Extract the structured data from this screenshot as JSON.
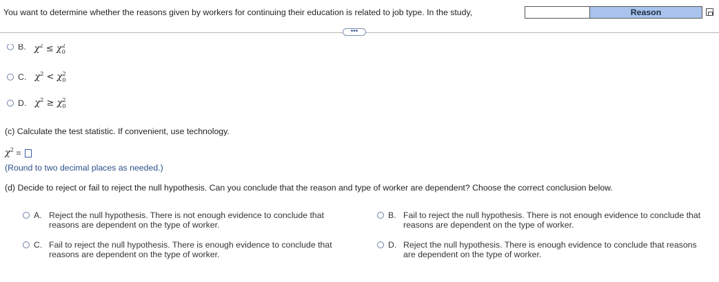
{
  "question_text": "You want to determine whether the reasons given by workers for continuing their education is related to job type. In the study,",
  "table_header": "Reason",
  "more_label": "•••",
  "part_b_options": [
    {
      "letter": "B.",
      "symbol": "≤"
    },
    {
      "letter": "C.",
      "symbol": "<"
    },
    {
      "letter": "D.",
      "symbol": "≥"
    }
  ],
  "chi": "χ",
  "sup2": "2",
  "sub0": "0",
  "part_c": {
    "prompt": "(c) Calculate the test statistic. If convenient, use technology.",
    "equals": "=",
    "hint": "(Round to two decimal places as needed.)"
  },
  "part_d": {
    "prompt": "(d) Decide to reject or fail to reject the null hypothesis. Can you conclude that the reason and type of worker are dependent? Choose the correct conclusion below.",
    "choices": [
      {
        "letter": "A.",
        "line1": "Reject the null hypothesis. There is not enough evidence to conclude that",
        "line2": "reasons are dependent on the type of worker."
      },
      {
        "letter": "B.",
        "line1": "Fail to reject the null hypothesis. There is not enough evidence to conclude that",
        "line2": "reasons are dependent on the type of worker."
      },
      {
        "letter": "C.",
        "line1": "Fail to reject the null hypothesis. There is enough evidence to conclude that",
        "line2": "reasons are dependent on the type of worker."
      },
      {
        "letter": "D.",
        "line1": "Reject the null hypothesis. There is enough evidence to conclude that reasons",
        "line2": "are dependent on the type of worker."
      }
    ]
  }
}
